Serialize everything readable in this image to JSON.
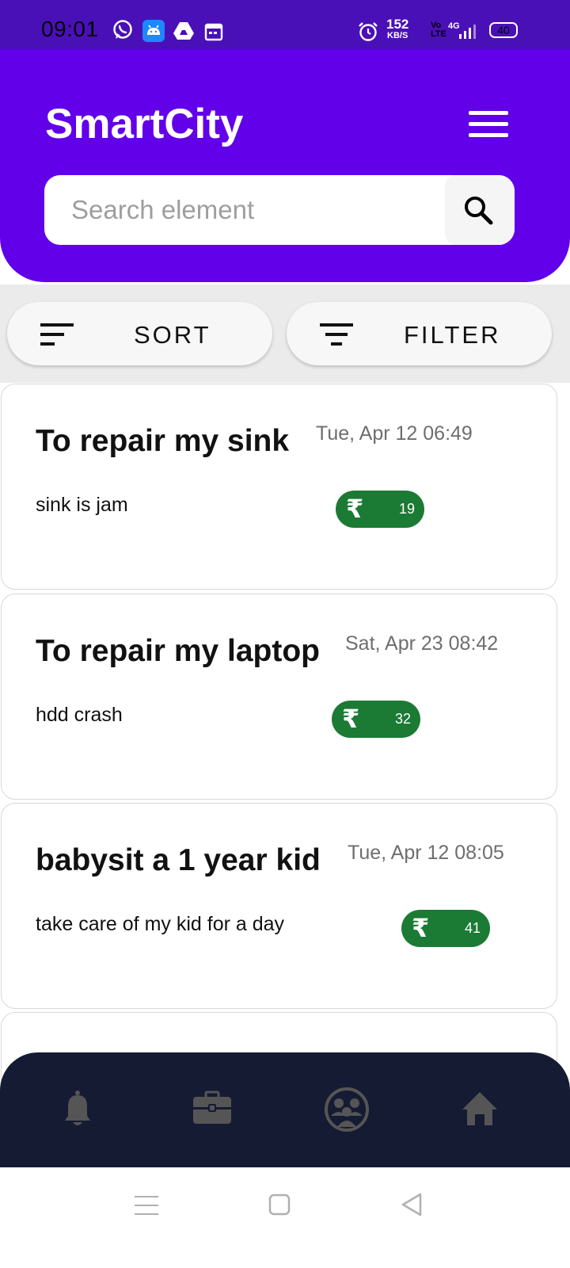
{
  "status_bar": {
    "time": "09:01",
    "net_speed_value": "152",
    "net_speed_unit": "KB/S",
    "volte_top": "Vo",
    "volte_bottom": "LTE",
    "network": "4G",
    "battery": "40",
    "left_icons": [
      "whatsapp-icon",
      "android-icon",
      "drive-icon",
      "calendar-icon"
    ],
    "right_icons": [
      "alarm-icon",
      "signal-icon"
    ]
  },
  "header": {
    "title": "SmartCity",
    "menu_icon": "hamburger-menu-icon",
    "background": "#6200ea"
  },
  "search": {
    "placeholder": "Search element",
    "icon": "search-icon"
  },
  "toolbar": {
    "sort_label": "SORT",
    "filter_label": "FILTER"
  },
  "cards": [
    {
      "title": "To repair my sink",
      "date": "Tue, Apr 12 06:49",
      "description": "sink is jam",
      "price": "19"
    },
    {
      "title": "To repair my laptop",
      "date": "Sat, Apr 23 08:42",
      "description": "hdd crash",
      "price": "32"
    },
    {
      "title": "babysit a 1 year kid",
      "date": "Tue, Apr 12 08:05",
      "description": "take care of my kid for a day",
      "price": "41"
    }
  ],
  "currency_symbol": "₹",
  "colors": {
    "accent": "#6200ea",
    "status_bar": "#4a10b8",
    "price_badge": "#1b7a34",
    "bottom_nav": "#151b33"
  },
  "bottom_nav": {
    "items": [
      {
        "icon": "bell-icon"
      },
      {
        "icon": "briefcase-icon"
      },
      {
        "icon": "community-icon"
      },
      {
        "icon": "home-icon"
      }
    ]
  },
  "system_nav": [
    "menu-icon",
    "home-square-icon",
    "back-icon"
  ]
}
